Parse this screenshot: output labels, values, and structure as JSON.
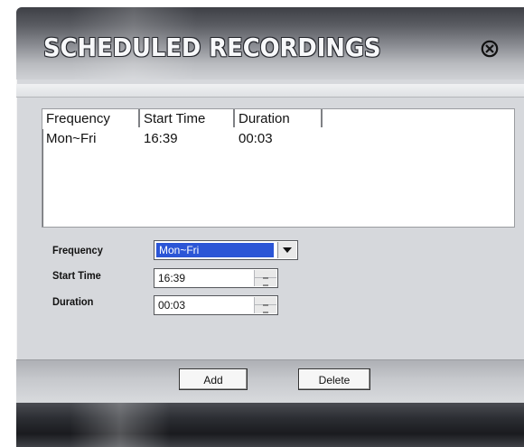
{
  "window": {
    "title": "SCHEDULED RECORDINGS",
    "close_icon": "circle-x-icon"
  },
  "list": {
    "columns": [
      "Frequency",
      "Start Time",
      "Duration"
    ],
    "rows": [
      {
        "frequency": "Mon~Fri",
        "start_time": "16:39",
        "duration": "00:03"
      }
    ]
  },
  "form": {
    "frequency_label": "Frequency",
    "frequency_value": "Mon~Fri",
    "start_time_label": "Start Time",
    "start_time_value": "16:39",
    "duration_label": "Duration",
    "duration_value": "00:03"
  },
  "buttons": {
    "add_label": "Add",
    "delete_label": "Delete"
  },
  "colors": {
    "selection": "#2b55d6",
    "window_bg": "#d6d8dc"
  }
}
